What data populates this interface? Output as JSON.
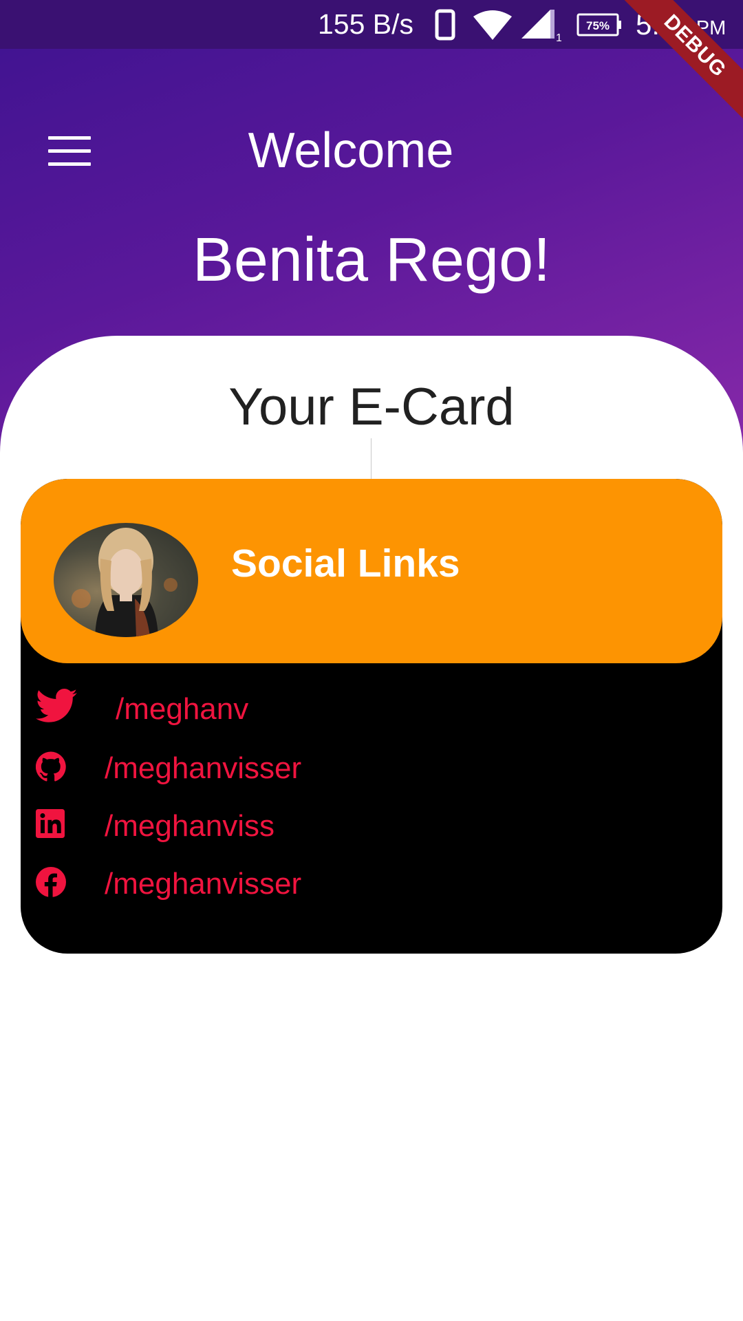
{
  "status_bar": {
    "net_speed": "155 B/s",
    "sim_label": "1",
    "battery": "75%",
    "time": "5:29",
    "ampm": "PM"
  },
  "debug_banner": "DEBUG",
  "header": {
    "menu_icon": "menu-icon",
    "title": "Welcome",
    "user_name": "Benita Rego!"
  },
  "sheet": {
    "title": "Your E-Card"
  },
  "card": {
    "title": "Social Links",
    "avatar_alt": "profile-photo",
    "links": [
      {
        "icon": "twitter-icon",
        "text": "/meghanv"
      },
      {
        "icon": "github-icon",
        "text": "/meghanvisser"
      },
      {
        "icon": "linkedin-icon",
        "text": "/meghanviss"
      },
      {
        "icon": "facebook-icon",
        "text": "/meghanvisser"
      }
    ]
  },
  "colors": {
    "header_start": "#3e1390",
    "header_end": "#8a2aaa",
    "card_header": "#fd9402",
    "link_text": "#f0143f",
    "card_body": "#000000"
  }
}
